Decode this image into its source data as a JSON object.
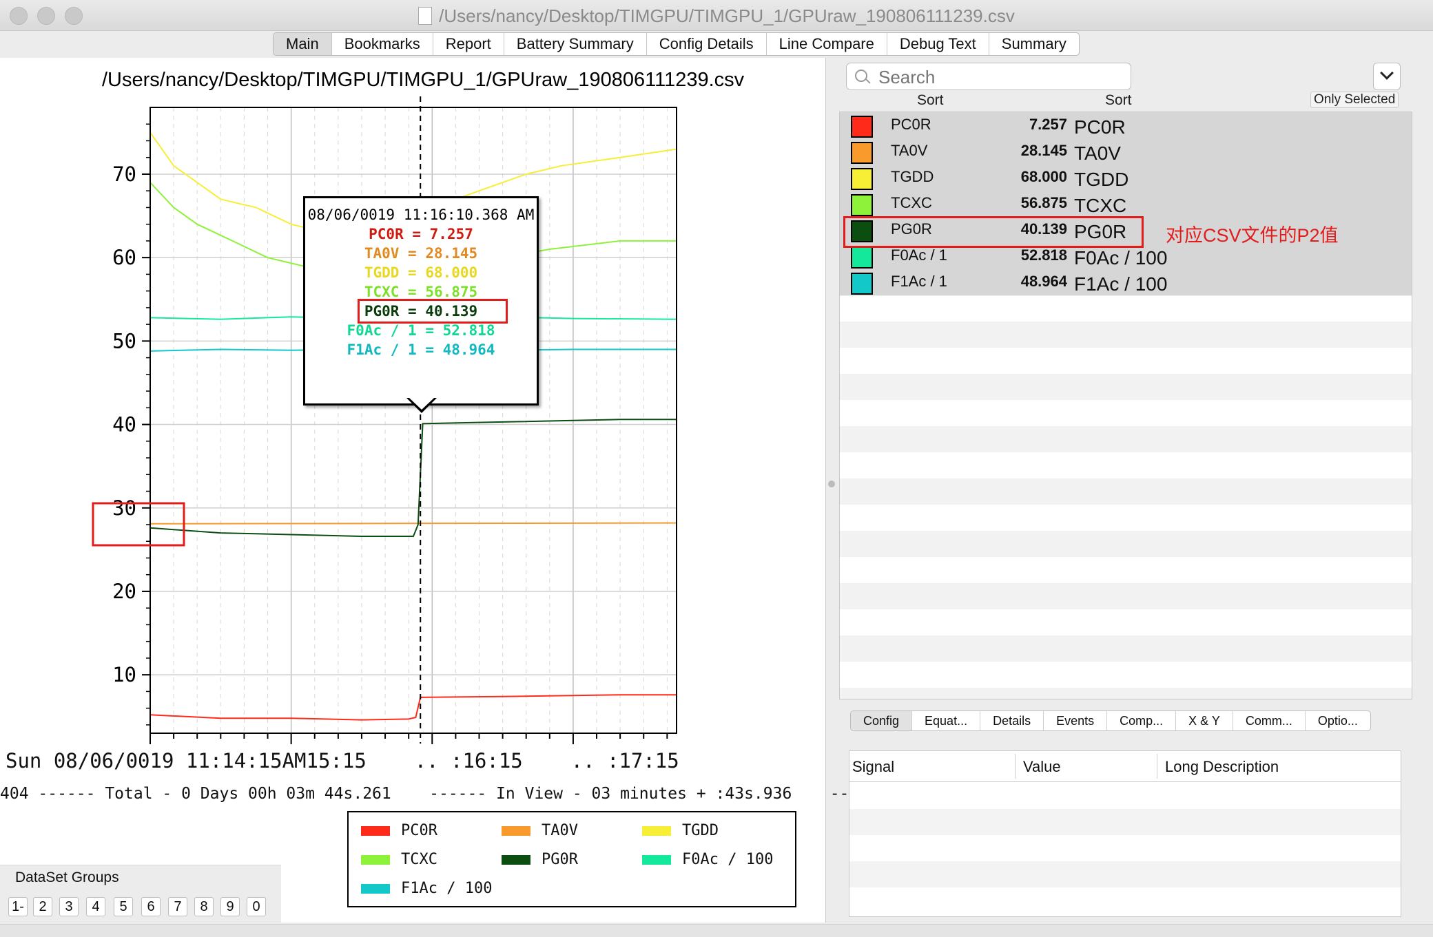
{
  "window": {
    "title": "/Users/nancy/Desktop/TIMGPU/TIMGPU_1/GPUraw_190806111239.csv"
  },
  "tabs": [
    "Main",
    "Bookmarks",
    "Report",
    "Battery Summary",
    "Config Details",
    "Line Compare",
    "Debug Text",
    "Summary"
  ],
  "chart": {
    "title": "/Users/nancy/Desktop/TIMGPU/TIMGPU_1/GPUraw_190806111239.csv"
  },
  "chart_data": {
    "type": "line",
    "title": "/Users/nancy/Desktop/TIMGPU/TIMGPU_1/GPUraw_190806111239.csv",
    "xlabel": "",
    "ylabel": "",
    "ylim": [
      3,
      78
    ],
    "yticks": [
      10,
      20,
      30,
      40,
      50,
      60,
      70
    ],
    "x_tick_labels": [
      "Sun 08/06/0019 11:14:15 AM",
      ".. :15:15",
      ".. :16:15",
      ".. :17:15"
    ],
    "x_range_seconds": [
      0,
      224
    ],
    "cursor_seconds": 115,
    "grid": true,
    "series": [
      {
        "name": "PC0R",
        "color": "#ff2a1a",
        "points": [
          [
            0,
            5.2
          ],
          [
            30,
            4.8
          ],
          [
            60,
            4.8
          ],
          [
            90,
            4.6
          ],
          [
            110,
            4.7
          ],
          [
            113,
            4.9
          ],
          [
            115,
            7.3
          ],
          [
            150,
            7.4
          ],
          [
            200,
            7.6
          ],
          [
            224,
            7.6
          ]
        ]
      },
      {
        "name": "TA0V",
        "color": "#f89a2c",
        "points": [
          [
            0,
            28.1
          ],
          [
            224,
            28.2
          ]
        ]
      },
      {
        "name": "TGDD",
        "color": "#f7ee36",
        "points": [
          [
            0,
            75
          ],
          [
            5,
            73
          ],
          [
            10,
            71
          ],
          [
            20,
            69
          ],
          [
            30,
            67
          ],
          [
            45,
            66
          ],
          [
            60,
            64
          ],
          [
            75,
            63
          ],
          [
            90,
            62
          ],
          [
            105,
            61
          ],
          [
            115,
            60
          ],
          [
            120,
            66
          ],
          [
            130,
            67
          ],
          [
            140,
            68
          ],
          [
            150,
            69
          ],
          [
            160,
            70
          ],
          [
            175,
            71
          ],
          [
            200,
            72
          ],
          [
            224,
            73
          ]
        ]
      },
      {
        "name": "TCXC",
        "color": "#8ef23a",
        "points": [
          [
            0,
            69
          ],
          [
            10,
            66
          ],
          [
            20,
            64
          ],
          [
            35,
            62
          ],
          [
            50,
            60
          ],
          [
            65,
            59
          ],
          [
            80,
            58
          ],
          [
            95,
            57
          ],
          [
            110,
            57
          ],
          [
            115,
            57
          ],
          [
            130,
            59
          ],
          [
            150,
            60
          ],
          [
            170,
            61
          ],
          [
            200,
            62
          ],
          [
            224,
            62
          ]
        ]
      },
      {
        "name": "PG0R",
        "color": "#0c4d10",
        "points": [
          [
            0,
            27.6
          ],
          [
            30,
            27
          ],
          [
            60,
            26.8
          ],
          [
            90,
            26.6
          ],
          [
            112,
            26.6
          ],
          [
            114,
            28
          ],
          [
            116,
            40.1
          ],
          [
            150,
            40.3
          ],
          [
            200,
            40.6
          ],
          [
            224,
            40.6
          ]
        ]
      },
      {
        "name": "F0Ac / 100",
        "color": "#14e89a",
        "points": [
          [
            0,
            52.8
          ],
          [
            30,
            52.6
          ],
          [
            60,
            52.9
          ],
          [
            90,
            52.7
          ],
          [
            120,
            52.8
          ],
          [
            150,
            52.9
          ],
          [
            180,
            52.7
          ],
          [
            224,
            52.6
          ]
        ]
      },
      {
        "name": "F1Ac / 100",
        "color": "#12c8c8",
        "points": [
          [
            0,
            48.8
          ],
          [
            30,
            49
          ],
          [
            60,
            48.9
          ],
          [
            90,
            49
          ],
          [
            120,
            49
          ],
          [
            150,
            48.9
          ],
          [
            180,
            49
          ],
          [
            224,
            49
          ]
        ]
      }
    ]
  },
  "tooltip": {
    "time": "08/06/0019 11:16:10.368 AM",
    "lines": [
      {
        "text": "PC0R = 7.257",
        "color": "#d01c10"
      },
      {
        "text": "TA0V = 28.145",
        "color": "#e08a20"
      },
      {
        "text": "TGDD = 68.000",
        "color": "#e8d820"
      },
      {
        "text": "TCXC = 56.875",
        "color": "#7ee02a"
      },
      {
        "text": "PG0R = 40.139",
        "color": "#0a3d0c"
      },
      {
        "text": "F0Ac / 1 = 52.818",
        "color": "#10d890"
      },
      {
        "text": "F1Ac / 1 = 48.964",
        "color": "#10b8c0"
      }
    ]
  },
  "xaxis_text": "Sun 08/06/0019 11:14:15AM15:15    .. :16:15    .. :17:15",
  "timeline": "404 ------ Total - 0 Days 00h 03m 44s.261    ------ In View - 03 minutes + :43s.936    ---",
  "legend": [
    {
      "name": "PC0R",
      "color": "#ff2a1a"
    },
    {
      "name": "TA0V",
      "color": "#f89a2c"
    },
    {
      "name": "TGDD",
      "color": "#f7ee36"
    },
    {
      "name": "TCXC",
      "color": "#8ef23a"
    },
    {
      "name": "PG0R",
      "color": "#0c4d10"
    },
    {
      "name": "F0Ac / 100",
      "color": "#14e89a"
    },
    {
      "name": "F1Ac / 100",
      "color": "#12c8c8"
    }
  ],
  "dataset_groups": {
    "label": "DataSet Groups",
    "buttons": [
      "1-",
      "2",
      "3",
      "4",
      "5",
      "6",
      "7",
      "8",
      "9",
      "0"
    ]
  },
  "search": {
    "placeholder": "Search"
  },
  "sort_labels": [
    "Sort",
    "Sort"
  ],
  "only_selected": "Only Selected",
  "signals": [
    {
      "name": "PC0R",
      "value": "7.257",
      "desc": "PC0R",
      "color": "#ff2a1a"
    },
    {
      "name": "TA0V",
      "value": "28.145",
      "desc": "TA0V",
      "color": "#f89a2c"
    },
    {
      "name": "TGDD",
      "value": "68.000",
      "desc": "TGDD",
      "color": "#f7ee36"
    },
    {
      "name": "TCXC",
      "value": "56.875",
      "desc": "TCXC",
      "color": "#8ef23a"
    },
    {
      "name": "PG0R",
      "value": "40.139",
      "desc": "PG0R",
      "color": "#0c4d10"
    },
    {
      "name": "F0Ac / 1",
      "value": "52.818",
      "desc": "F0Ac / 100",
      "color": "#14e89a"
    },
    {
      "name": "F1Ac / 1",
      "value": "48.964",
      "desc": "F1Ac / 100",
      "color": "#12c8c8"
    }
  ],
  "annotation": "对应CSV文件的P2值",
  "bottom_tabs": [
    "Config",
    "Equat...",
    "Details",
    "Events",
    "Comp...",
    "X & Y",
    "Comm...",
    "Optio..."
  ],
  "detail_headers": [
    "Signal",
    "Value",
    "Long Description"
  ]
}
